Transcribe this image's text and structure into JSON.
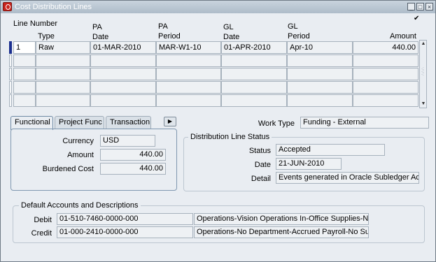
{
  "window": {
    "title": "Cost Distribution Lines"
  },
  "headers": {
    "line_number": "Line Number",
    "type": "Type",
    "pa_date_1": "PA",
    "pa_date_2": "Date",
    "pa_period_1": "PA",
    "pa_period_2": "Period",
    "gl_date_1": "GL",
    "gl_date_2": "Date",
    "gl_period_1": "GL",
    "gl_period_2": "Period",
    "amount": "Amount"
  },
  "lines": [
    {
      "line_number": "1",
      "type": "Raw",
      "pa_date": "01-MAR-2010",
      "pa_period": "MAR-W1-10",
      "gl_date": "01-APR-2010",
      "gl_period": "Apr-10",
      "amount": "440.00"
    }
  ],
  "tabs": [
    "Functional",
    "Project Func",
    "Transaction"
  ],
  "active_tab": "Functional",
  "functional": {
    "currency_label": "Currency",
    "currency": "USD",
    "amount_label": "Amount",
    "amount": "440.00",
    "burdened_cost_label": "Burdened Cost",
    "burdened_cost": "440.00"
  },
  "work_type": {
    "label": "Work Type",
    "value": "Funding - External"
  },
  "distribution_line_status": {
    "title": "Distribution Line Status",
    "status_label": "Status",
    "status": "Accepted",
    "date_label": "Date",
    "date": "21-JUN-2010",
    "detail_label": "Detail",
    "detail": "Events generated in Oracle Subledger Acc"
  },
  "default_accounts": {
    "title": "Default Accounts and Descriptions",
    "debit_label": "Debit",
    "debit_account": "01-510-7460-0000-000",
    "debit_description": "Operations-Vision Operations In-Office Supplies-No S",
    "credit_label": "Credit",
    "credit_account": "01-000-2410-0000-000",
    "credit_description": "Operations-No Department-Accrued Payroll-No Sub A"
  },
  "icons": {
    "app": "oracle-icon",
    "minimize": "minimize-icon",
    "maximize": "maximize-icon",
    "close": "close-icon"
  }
}
